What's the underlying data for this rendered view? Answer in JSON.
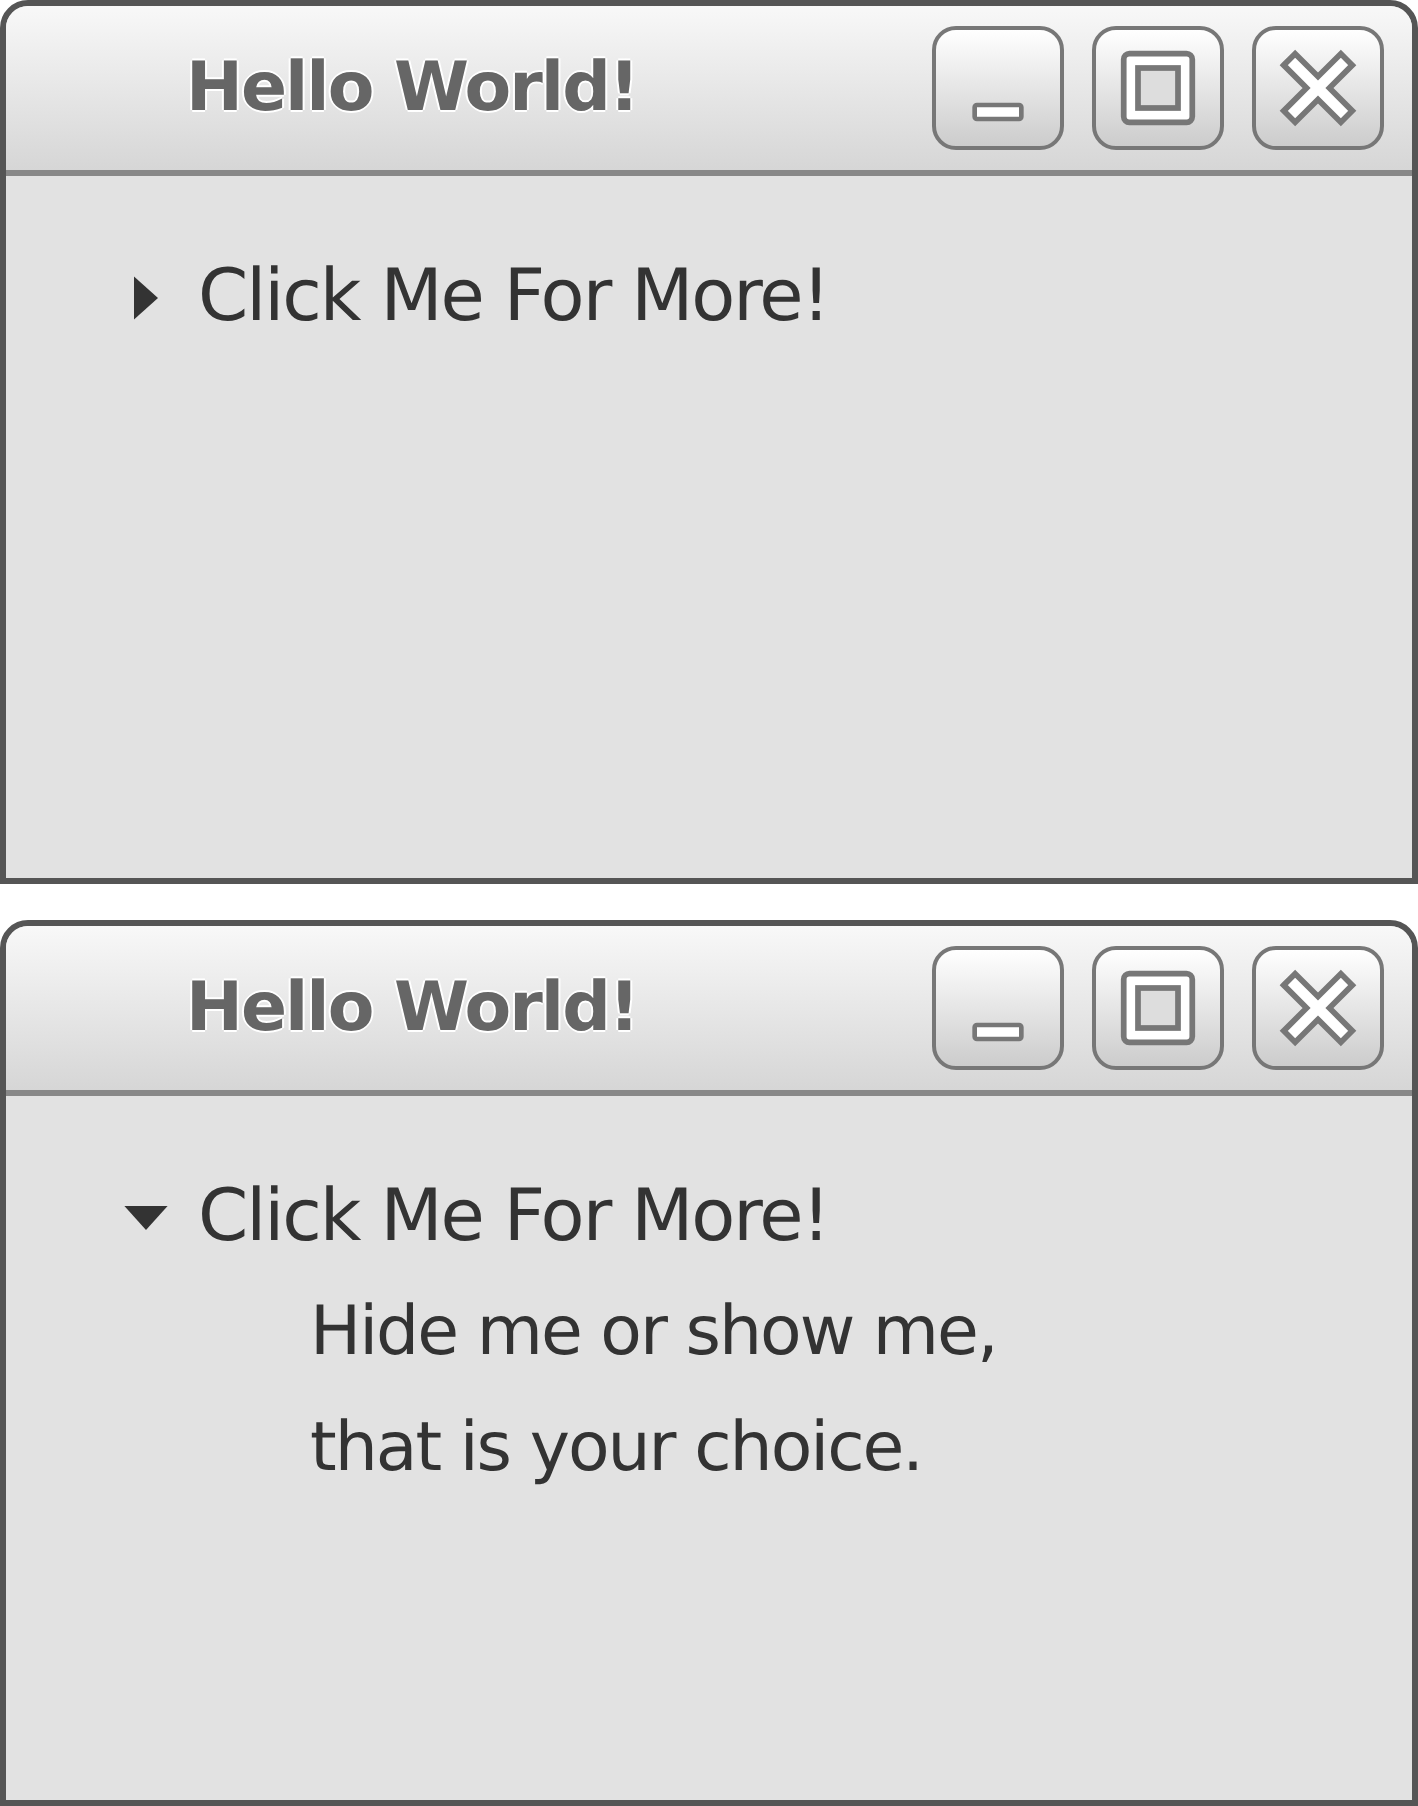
{
  "windows": [
    {
      "title": "Hello World!",
      "expander": {
        "label": "Click Me For More!",
        "expanded": false
      }
    },
    {
      "title": "Hello World!",
      "expander": {
        "label": "Click Me For More!",
        "expanded": true,
        "content": [
          "Hide me or show me,",
          "that is your choice."
        ]
      }
    }
  ]
}
